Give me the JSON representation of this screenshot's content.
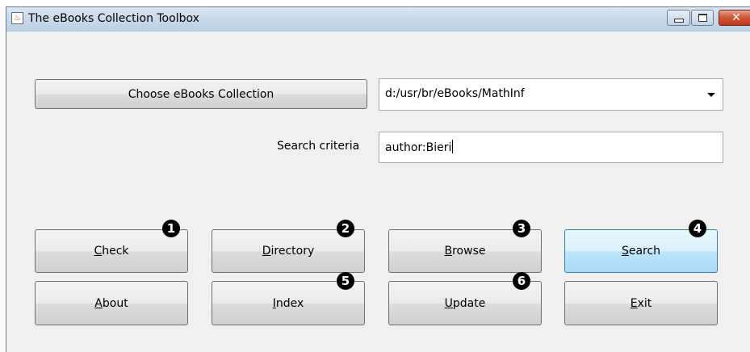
{
  "window": {
    "title": "The eBooks Collection Toolbox",
    "app_icon": "java-cup-icon",
    "controls": {
      "minimize": "minimize-icon",
      "maximize": "maximize-icon",
      "close": "close-icon",
      "close_glyph": "✕"
    }
  },
  "collection": {
    "choose_button": "Choose eBooks Collection",
    "path": "d:/usr/br/eBooks/MathInf"
  },
  "search": {
    "label": "Search criteria",
    "value": "author:Bieri"
  },
  "buttons": {
    "check": {
      "mnemonic": "C",
      "rest": "heck"
    },
    "directory": {
      "mnemonic": "D",
      "rest": "irectory"
    },
    "browse": {
      "mnemonic": "B",
      "rest": "rowse"
    },
    "search": {
      "mnemonic": "S",
      "rest": "earch"
    },
    "about": {
      "mnemonic": "A",
      "rest": "bout"
    },
    "index": {
      "mnemonic": "I",
      "rest": "ndex"
    },
    "update": {
      "mnemonic": "U",
      "rest": "pdate"
    },
    "exit": {
      "mnemonic": "E",
      "rest": "xit"
    }
  },
  "badges": [
    "1",
    "2",
    "3",
    "4",
    "5",
    "6"
  ],
  "colors": {
    "focus_border": "#3c7fb1",
    "close_button": "#c0391d"
  }
}
